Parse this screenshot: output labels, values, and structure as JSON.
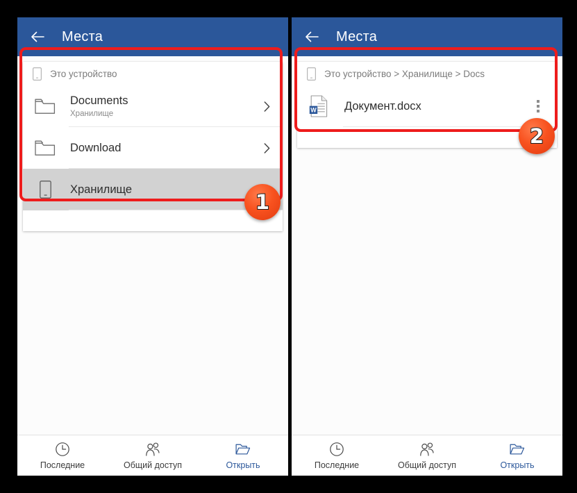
{
  "app": {
    "title": "Места",
    "back_icon": "arrow-left-icon",
    "header_color": "#2b579a",
    "accent_color": "#2b579a",
    "highlight_color": "#ee1c1c",
    "badge_color": "#f8521f"
  },
  "left_panel": {
    "path": {
      "icon": "device-icon",
      "text": "Это устройство"
    },
    "rows": [
      {
        "icon": "folder-icon",
        "title": "Documents",
        "subtitle": "Хранилище",
        "trailing": "chevron-right-icon",
        "selected": false
      },
      {
        "icon": "folder-icon",
        "title": "Download",
        "subtitle": "",
        "trailing": "chevron-right-icon",
        "selected": false
      },
      {
        "icon": "device-icon",
        "title": "Хранилище",
        "subtitle": "",
        "trailing": "chevron-right-icon",
        "selected": true
      }
    ],
    "badge": "1"
  },
  "right_panel": {
    "path": {
      "icon": "device-icon",
      "text": "Это устройство > Хранилище > Docs"
    },
    "rows": [
      {
        "icon": "word-document-icon",
        "title": "Документ.docx",
        "subtitle": "",
        "trailing": "kebab-menu-icon",
        "selected": false
      }
    ],
    "badge": "2"
  },
  "tabs": [
    {
      "label": "Последние",
      "icon": "clock-icon",
      "active": false
    },
    {
      "label": "Общий доступ",
      "icon": "people-icon",
      "active": false
    },
    {
      "label": "Открыть",
      "icon": "folder-open-icon",
      "active": true
    }
  ]
}
